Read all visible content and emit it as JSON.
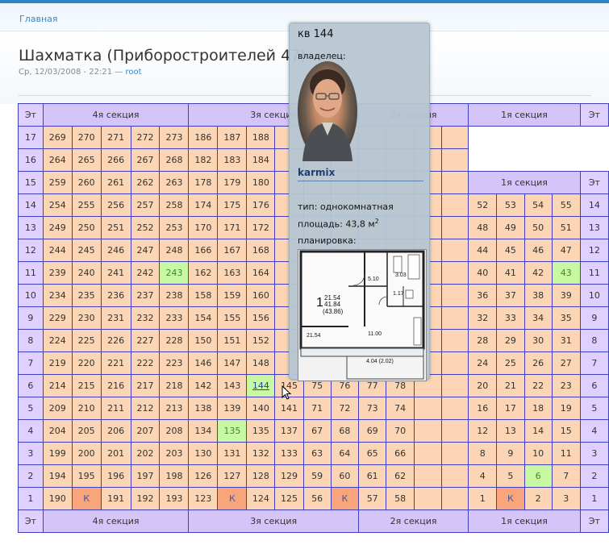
{
  "breadcrumb": {
    "home": "Главная"
  },
  "page": {
    "title": "Шахматка (Приборостроителей 47)",
    "date": "Ср, 12/03/2008 - 22:21 — ",
    "author": "root"
  },
  "grid": {
    "floor_label": "Эт",
    "section_labels": [
      "4я секция",
      "3я секция",
      "2я секция",
      "1я секция"
    ],
    "k_label": "К",
    "rows": [
      {
        "floor": "17",
        "s4": [
          "269",
          "270",
          "271",
          "272",
          "273"
        ],
        "s3": [
          "186",
          "187",
          "188",
          "",
          "",
          ""
        ],
        "s2": [
          "",
          "",
          "",
          ""
        ],
        "s1": []
      },
      {
        "floor": "16",
        "s4": [
          "264",
          "265",
          "266",
          "267",
          "268"
        ],
        "s3": [
          "182",
          "183",
          "184",
          "",
          "",
          ""
        ],
        "s2": [
          "",
          "",
          "",
          ""
        ],
        "s1": []
      },
      {
        "floor": "15",
        "s4": [
          "259",
          "260",
          "261",
          "262",
          "263"
        ],
        "s3": [
          "178",
          "179",
          "180",
          "",
          "",
          ""
        ],
        "s2": [
          "",
          "",
          "",
          ""
        ],
        "s1": []
      },
      {
        "floor": "14",
        "s4": [
          "254",
          "255",
          "256",
          "257",
          "258"
        ],
        "s3": [
          "174",
          "175",
          "176",
          "",
          "",
          ""
        ],
        "s2": [
          "",
          "",
          "",
          ""
        ],
        "s1": [
          "52",
          "53",
          "54",
          "55"
        ]
      },
      {
        "floor": "13",
        "s4": [
          "249",
          "250",
          "251",
          "252",
          "253"
        ],
        "s3": [
          "170",
          "171",
          "172",
          "",
          "",
          ""
        ],
        "s2": [
          "",
          "",
          "",
          ""
        ],
        "s1": [
          "48",
          "49",
          "50",
          "51"
        ]
      },
      {
        "floor": "12",
        "s4": [
          "244",
          "245",
          "246",
          "247",
          "248"
        ],
        "s3": [
          "166",
          "167",
          "168",
          "",
          "",
          ""
        ],
        "s2": [
          "",
          "",
          "",
          ""
        ],
        "s1": [
          "44",
          "45",
          "46",
          "47"
        ]
      },
      {
        "floor": "11",
        "s4": [
          "239",
          "240",
          "241",
          "242",
          "243"
        ],
        "s3": [
          "162",
          "163",
          "164",
          "",
          "",
          ""
        ],
        "s2": [
          "",
          "",
          "",
          ""
        ],
        "s1": [
          "40",
          "41",
          "42",
          "43"
        ]
      },
      {
        "floor": "10",
        "s4": [
          "234",
          "235",
          "236",
          "237",
          "238"
        ],
        "s3": [
          "158",
          "159",
          "160",
          "",
          "",
          ""
        ],
        "s2": [
          "",
          "",
          "",
          ""
        ],
        "s1": [
          "36",
          "37",
          "38",
          "39"
        ]
      },
      {
        "floor": "9",
        "s4": [
          "229",
          "230",
          "231",
          "232",
          "233"
        ],
        "s3": [
          "154",
          "155",
          "156",
          "",
          "",
          ""
        ],
        "s2": [
          "",
          "",
          "",
          ""
        ],
        "s1": [
          "32",
          "33",
          "34",
          "35"
        ]
      },
      {
        "floor": "8",
        "s4": [
          "224",
          "225",
          "226",
          "227",
          "228"
        ],
        "s3": [
          "150",
          "151",
          "152",
          "",
          "",
          ""
        ],
        "s2": [
          "",
          "",
          "",
          ""
        ],
        "s1": [
          "28",
          "29",
          "30",
          "31"
        ]
      },
      {
        "floor": "7",
        "s4": [
          "219",
          "220",
          "221",
          "222",
          "223"
        ],
        "s3": [
          "146",
          "147",
          "148",
          "",
          "",
          ""
        ],
        "s2": [
          "",
          "",
          "",
          ""
        ],
        "s1": [
          "24",
          "25",
          "26",
          "27"
        ]
      },
      {
        "floor": "6",
        "s4": [
          "214",
          "215",
          "216",
          "217",
          "218"
        ],
        "s3": [
          "142",
          "143",
          "144",
          "145",
          "75",
          "76"
        ],
        "s2": [
          "77",
          "78",
          "",
          ""
        ],
        "s1": [
          "20",
          "21",
          "22",
          "23"
        ]
      },
      {
        "floor": "5",
        "s4": [
          "209",
          "210",
          "211",
          "212",
          "213"
        ],
        "s3": [
          "138",
          "139",
          "140",
          "141",
          "71",
          "72"
        ],
        "s2": [
          "73",
          "74",
          "",
          ""
        ],
        "s1": [
          "16",
          "17",
          "18",
          "19"
        ]
      },
      {
        "floor": "4",
        "s4": [
          "204",
          "205",
          "206",
          "207",
          "208"
        ],
        "s3": [
          "134",
          "135",
          "135",
          "137",
          "67",
          "68"
        ],
        "s2": [
          "69",
          "70",
          "",
          ""
        ],
        "s1": [
          "12",
          "13",
          "14",
          "15"
        ]
      },
      {
        "floor": "3",
        "s4": [
          "199",
          "200",
          "201",
          "202",
          "203"
        ],
        "s3": [
          "130",
          "131",
          "132",
          "133",
          "63",
          "64"
        ],
        "s2": [
          "65",
          "66",
          "",
          ""
        ],
        "s1": [
          "8",
          "9",
          "10",
          "11"
        ]
      },
      {
        "floor": "2",
        "s4": [
          "194",
          "195",
          "196",
          "197",
          "198"
        ],
        "s3": [
          "126",
          "127",
          "128",
          "129",
          "59",
          "60"
        ],
        "s2": [
          "61",
          "62",
          "",
          ""
        ],
        "s1": [
          "4",
          "5",
          "6",
          "7"
        ]
      },
      {
        "floor": "1",
        "s4": [
          "190",
          "К",
          "191",
          "192",
          "193"
        ],
        "s3": [
          "123",
          "К",
          "124",
          "125",
          "56",
          "К"
        ],
        "s2": [
          "57",
          "58",
          "",
          ""
        ],
        "s1": [
          "1",
          "К",
          "2",
          "3"
        ]
      }
    ]
  },
  "popup": {
    "apt": "кв 144",
    "owner_label": "владелец:",
    "username": "karmix",
    "type": "тип: однокомнатная",
    "area": "площадь: 43,8 м",
    "area_sup": "2",
    "plan_label": "планировка:",
    "plan": {
      "room_no": "1",
      "area_top": "21.54",
      "area_mid": "41.84",
      "area_total": "(43.86)",
      "left_dim": "21.54",
      "hall": "5.10",
      "bath": "3.03",
      "wc": "1.17",
      "kitchen": "11.00",
      "balcony": "4.04 (2.02)"
    }
  }
}
